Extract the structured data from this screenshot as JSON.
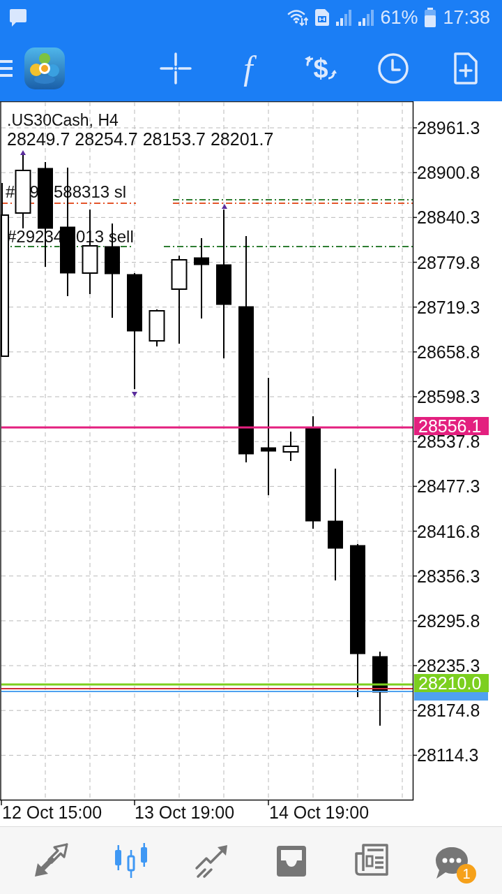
{
  "status_bar": {
    "battery_text": "61%",
    "time": "17:38"
  },
  "toolbar": {
    "tools": [
      {
        "kind": "crosshair"
      },
      {
        "kind": "function",
        "glyph": "f"
      },
      {
        "kind": "trade",
        "glyph": "$"
      },
      {
        "kind": "period"
      },
      {
        "kind": "new-order"
      }
    ]
  },
  "chart": {
    "symbol_title": ".US30Cash, H4",
    "ohlc": "28249.7 28254.7 28153.7 28201.7",
    "order_lines": [
      {
        "color": "#e4552b",
        "label_parts": [
          "#",
          "9",
          "588313 sl"
        ]
      },
      {
        "color": "#2e7d32"
      },
      {
        "color": "#2e7d32",
        "label_parts": [
          "#29234",
          "013 sell"
        ]
      }
    ],
    "price_lines": [
      {
        "kind": "tagged",
        "color": "#e3207f",
        "tag": "28556.1"
      },
      {
        "kind": "tagged",
        "color": "#7ccf1f",
        "tag": "28210.0"
      },
      {
        "kind": "plain",
        "color": "#cf2b36"
      },
      {
        "kind": "covered-tag",
        "color": "#4fa1f0"
      }
    ],
    "price_ticks": [
      "28961.3",
      "28900.8",
      "28840.3",
      "28779.8",
      "28719.3",
      "28658.8",
      "28598.3",
      "28537.8",
      "28477.3",
      "28416.8",
      "28356.3",
      "28295.8",
      "28235.3",
      "28174.8",
      "28114.3"
    ],
    "time_labels": [
      "12 Oct 15:00",
      "13 Oct 19:00",
      "14 Oct 19:00"
    ]
  },
  "bottom_nav": [
    {
      "kind": "quotes",
      "selected": false
    },
    {
      "kind": "chart",
      "selected": true
    },
    {
      "kind": "trade",
      "selected": false
    },
    {
      "kind": "history",
      "selected": false
    },
    {
      "kind": "news",
      "selected": false
    },
    {
      "kind": "messages",
      "selected": false,
      "badge": "1"
    }
  ]
}
